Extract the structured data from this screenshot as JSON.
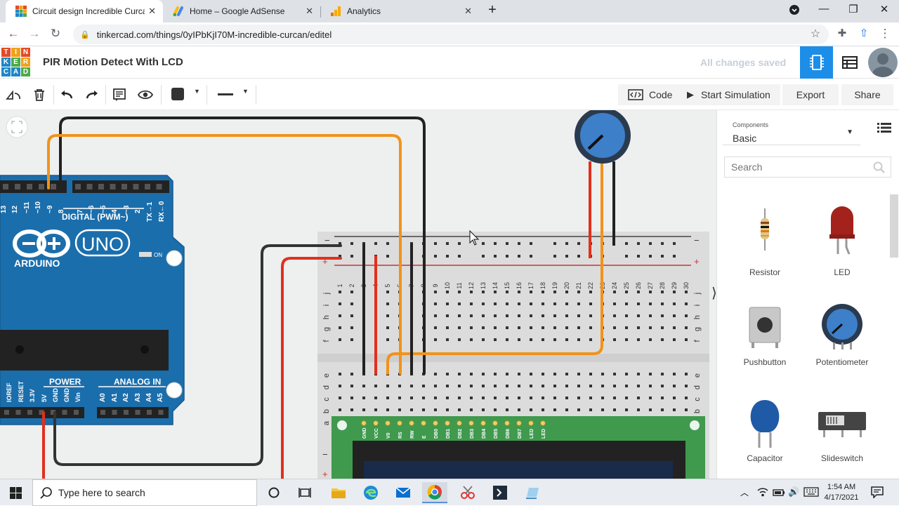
{
  "browser": {
    "tabs": [
      {
        "title": "Circuit design Incredible Curcan",
        "active": true
      },
      {
        "title": "Home – Google AdSense",
        "active": false
      },
      {
        "title": "Analytics",
        "active": false
      }
    ],
    "new_tab": "+",
    "url": "tinkercad.com/things/0yIPbKjI70M-incredible-curcan/editel"
  },
  "app": {
    "logo_letters": [
      "T",
      "I",
      "N",
      "K",
      "E",
      "R",
      "C",
      "A",
      "D"
    ],
    "logo_colors": [
      "#e24b26",
      "#f0a11b",
      "#e24b26",
      "#1e88c7",
      "#4cab48",
      "#f0a11b",
      "#1e88c7",
      "#1e88c7",
      "#4cab48"
    ],
    "title": "PIR Motion Detect With LCD",
    "save_status": "All changes saved",
    "accent": "#1c8ee8"
  },
  "toolbar": {
    "icons": [
      "rotate-icon",
      "delete-icon",
      "undo-icon",
      "redo-icon",
      "notes-icon",
      "visibility-icon",
      "color-swatch",
      "line-style"
    ],
    "code_label": "Code",
    "start_sim_label": "Start Simulation",
    "export_label": "Export",
    "share_label": "Share"
  },
  "board": {
    "model": "UNO",
    "brand": "ARDUINO",
    "digital_label": "DIGITAL (PWM~)",
    "power_label": "POWER",
    "analog_label": "ANALOG IN",
    "on_label": "ON",
    "digital_pins": [
      "13",
      "12",
      "~11",
      "~10",
      "~9",
      "8",
      "7",
      "~6",
      "~5",
      "4",
      "~3",
      "2",
      "TX→1",
      "RX←0"
    ],
    "power_pins": [
      "IOREF",
      "RESET",
      "3.3V",
      "5V",
      "GND",
      "GND",
      "Vin"
    ],
    "analog_pins": [
      "A0",
      "A1",
      "A2",
      "A3",
      "A4",
      "A5"
    ]
  },
  "breadboard": {
    "columns": [
      "1",
      "",
      "",
      "",
      "5",
      "",
      "",
      "",
      "",
      "10",
      "",
      "",
      "",
      "",
      "15",
      "",
      "",
      "",
      "",
      "20",
      "",
      "",
      "",
      "",
      "25",
      "",
      "",
      "",
      "",
      "30"
    ],
    "rows_top": [
      "j",
      "i",
      "h",
      "g",
      "f"
    ],
    "rows_bottom": [
      "e",
      "d",
      "c",
      "b",
      "a"
    ],
    "minus": "−",
    "plus": "+"
  },
  "lcd": {
    "pins": [
      "GND",
      "VCC",
      "V0",
      "RS",
      "RW",
      "E",
      "DB0",
      "DB1",
      "DB2",
      "DB3",
      "DB4",
      "DB5",
      "DB6",
      "DB7",
      "LED",
      "LED"
    ]
  },
  "panel": {
    "section_caption": "Components",
    "section_value": "Basic",
    "search_placeholder": "Search",
    "components": [
      {
        "name": "Resistor"
      },
      {
        "name": "LED"
      },
      {
        "name": "Pushbutton"
      },
      {
        "name": "Potentiometer"
      },
      {
        "name": "Capacitor"
      },
      {
        "name": "Slideswitch"
      }
    ]
  },
  "taskbar": {
    "search_placeholder": "Type here to search",
    "time": "1:54 AM",
    "date": "4/17/2021"
  }
}
